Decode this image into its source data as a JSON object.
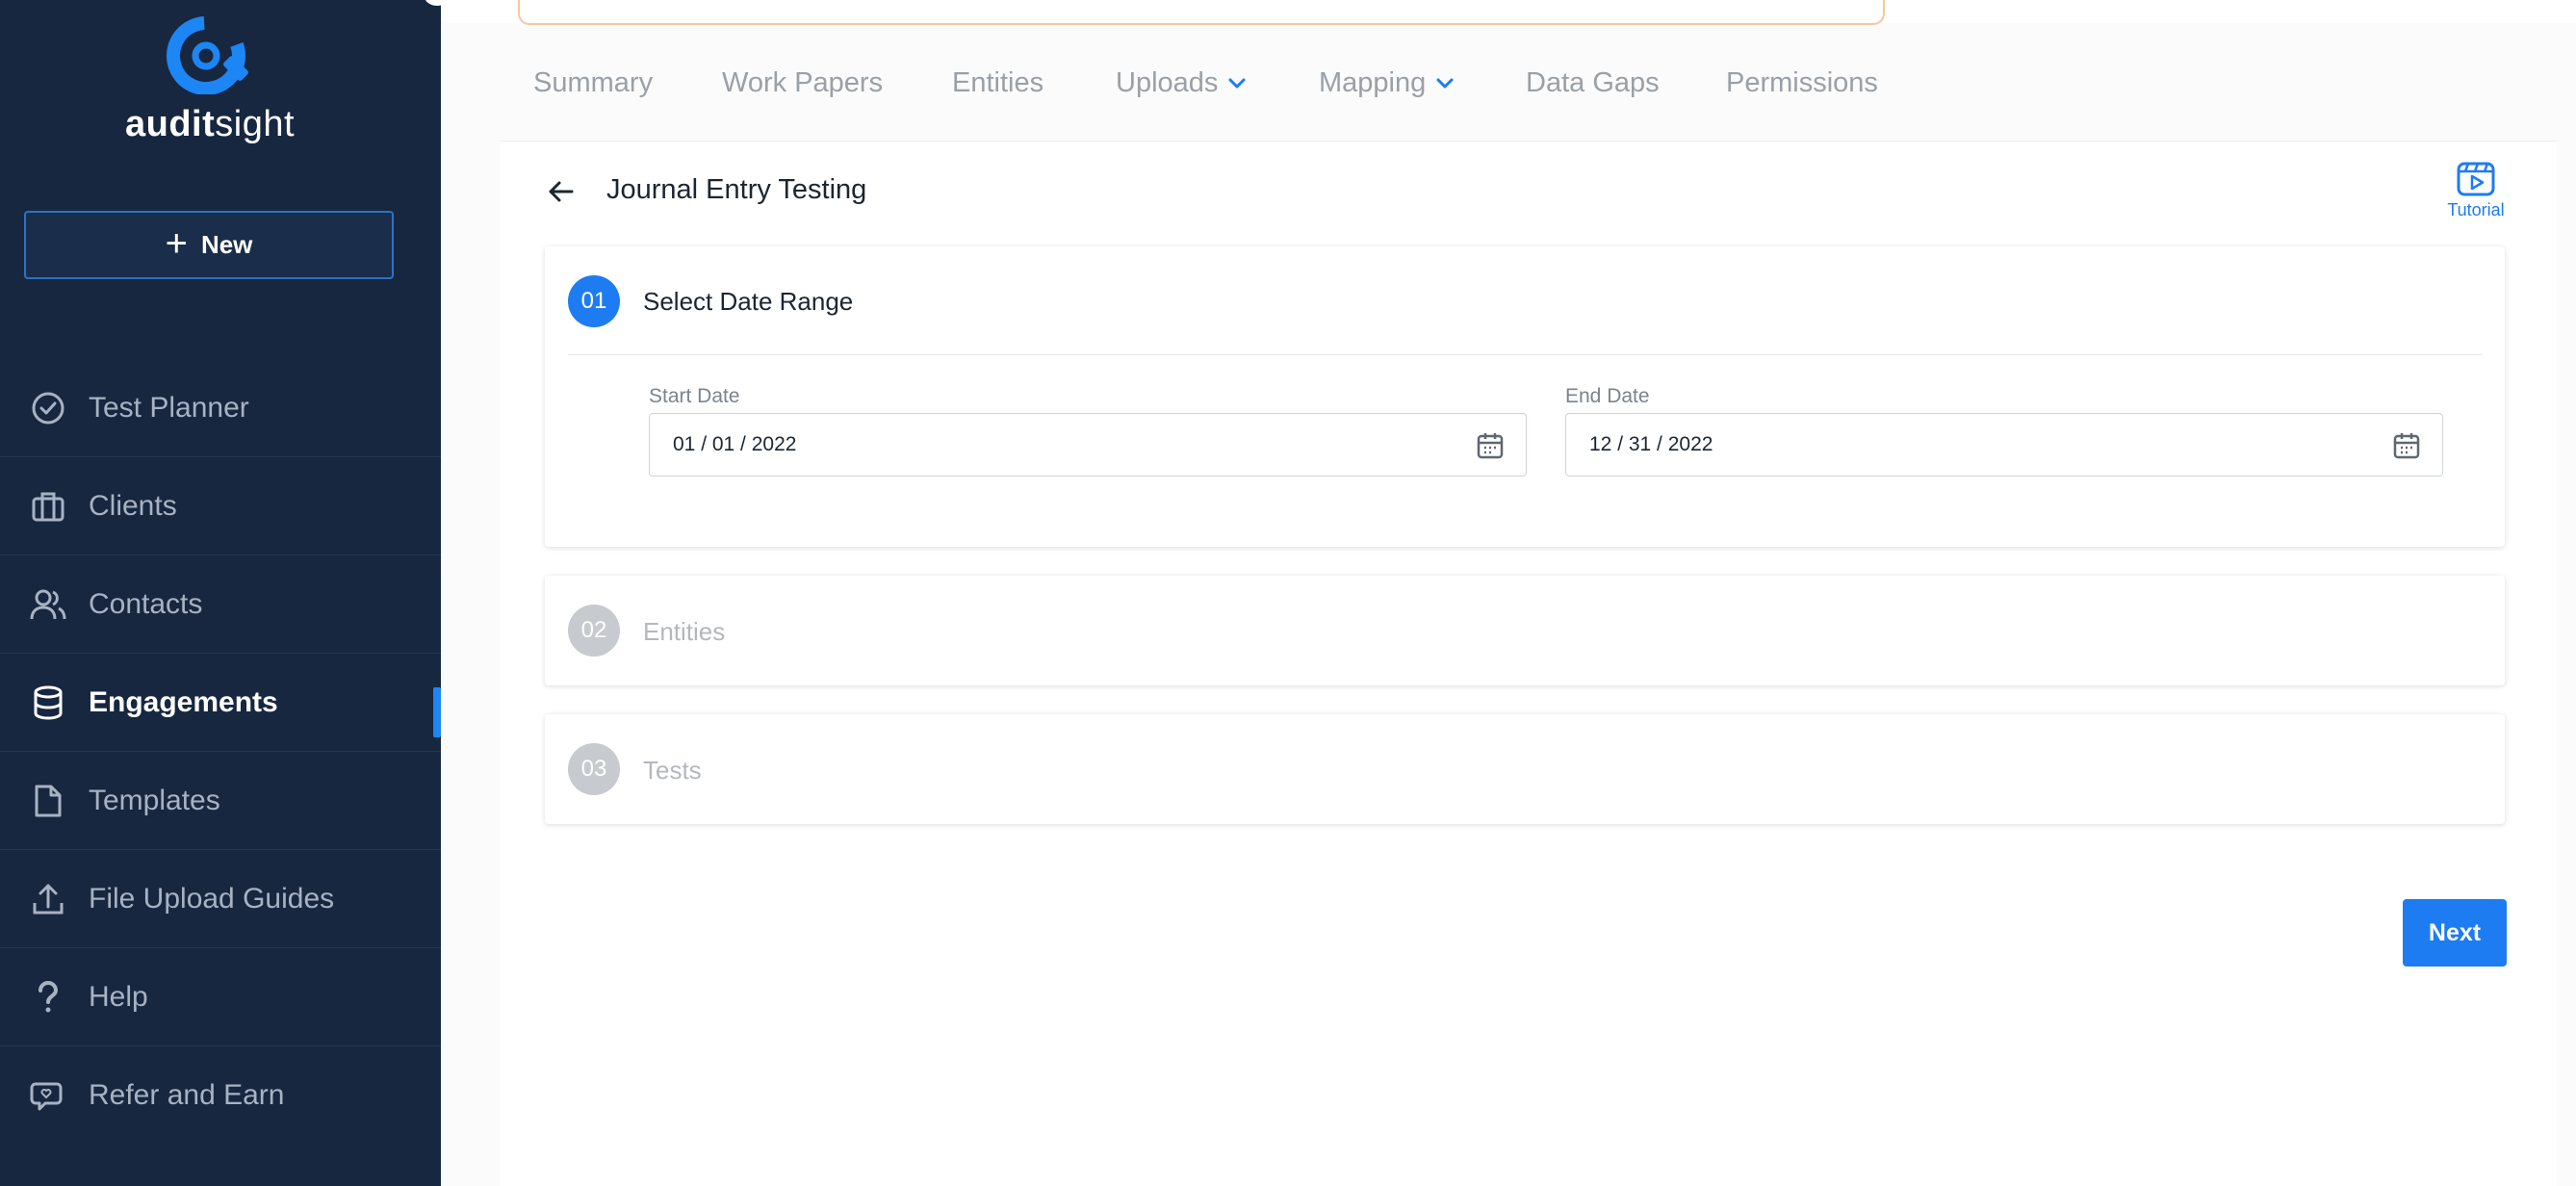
{
  "app": {
    "logo_bold": "audit",
    "logo_light": "sight"
  },
  "sidebar": {
    "new_label": "New",
    "items": [
      {
        "label": "Test Planner",
        "icon": "check-circle-icon"
      },
      {
        "label": "Clients",
        "icon": "briefcase-icon"
      },
      {
        "label": "Contacts",
        "icon": "users-icon"
      },
      {
        "label": "Engagements",
        "icon": "database-icon",
        "active": true
      },
      {
        "label": "Templates",
        "icon": "file-icon"
      },
      {
        "label": "File Upload Guides",
        "icon": "upload-icon"
      },
      {
        "label": "Help",
        "icon": "question-icon"
      },
      {
        "label": "Refer and Earn",
        "icon": "refer-icon"
      }
    ]
  },
  "tabs": [
    {
      "label": "Summary"
    },
    {
      "label": "Work Papers"
    },
    {
      "label": "Entities"
    },
    {
      "label": "Uploads",
      "dropdown": true
    },
    {
      "label": "Mapping",
      "dropdown": true
    },
    {
      "label": "Data Gaps"
    },
    {
      "label": "Permissions"
    }
  ],
  "page": {
    "title": "Journal Entry Testing",
    "tutorial_label": "Tutorial"
  },
  "steps": [
    {
      "number": "01",
      "title": "Select Date Range",
      "active": true
    },
    {
      "number": "02",
      "title": "Entities"
    },
    {
      "number": "03",
      "title": "Tests"
    }
  ],
  "date_range": {
    "start_label": "Start Date",
    "start_value": "01 / 01 / 2022",
    "end_label": "End Date",
    "end_value": "12 / 31 / 2022"
  },
  "actions": {
    "next_label": "Next"
  },
  "colors": {
    "sidebar_bg": "#172740",
    "accent": "#1d7cf2",
    "step_inactive": "#c7cace"
  }
}
